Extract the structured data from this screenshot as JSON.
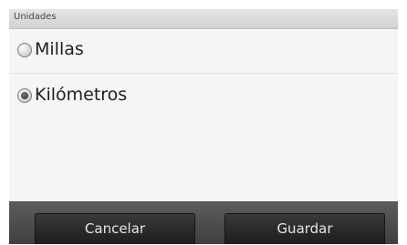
{
  "header": {
    "title": "Unidades"
  },
  "options": [
    {
      "label": "Millas",
      "selected": false
    },
    {
      "label": "Kilómetros",
      "selected": true
    }
  ],
  "footer": {
    "cancel_label": "Cancelar",
    "save_label": "Guardar"
  }
}
